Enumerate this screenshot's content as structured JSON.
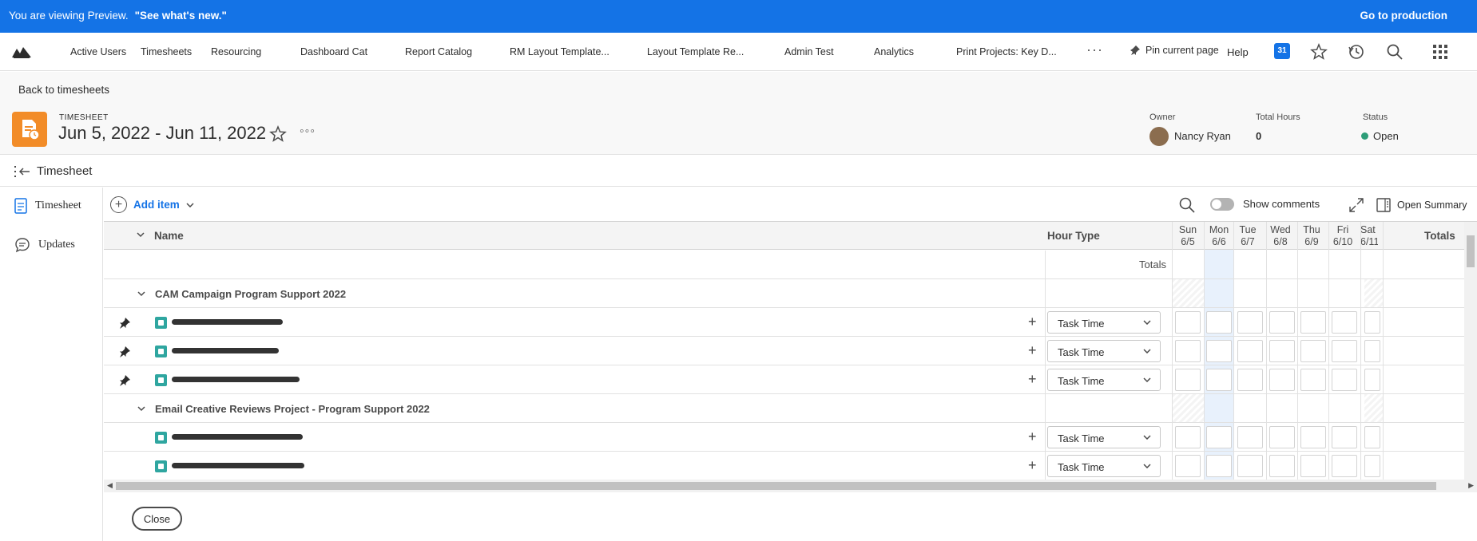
{
  "banner": {
    "message": "You are viewing Preview.",
    "link": "\"See what's new.\"",
    "production": "Go to production"
  },
  "nav": {
    "items": [
      "Active Users",
      "Timesheets",
      "Resourcing",
      "Dashboard Cat",
      "Report Catalog",
      "RM Layout Template...",
      "Layout Template Re...",
      "Admin Test",
      "Analytics",
      "Print Projects: Key D..."
    ],
    "more": "···",
    "pin": "Pin current page",
    "help": "Help",
    "calendar_badge": "31",
    "icons": [
      "logo-icon",
      "pin-icon",
      "calendar-icon",
      "star-icon",
      "history-icon",
      "search-icon",
      "apps-grid-icon"
    ]
  },
  "header": {
    "back": "Back to timesheets",
    "label": "TIMESHEET",
    "title": "Jun 5, 2022 - Jun 11, 2022",
    "more": "◦◦◦",
    "owner_label": "Owner",
    "owner": "Nancy Ryan",
    "hours_label": "Total Hours",
    "hours": "0",
    "status_label": "Status",
    "status": "Open",
    "status_color": "#2d9d78"
  },
  "section": {
    "title": "Timesheet"
  },
  "sidenav": {
    "items": [
      "Timesheet",
      "Updates"
    ]
  },
  "toolbar": {
    "add_item": "Add item",
    "show_comments": "Show comments",
    "open_summary": "Open Summary"
  },
  "grid": {
    "name_header": "Name",
    "hour_type_header": "Hour Type",
    "days": [
      {
        "day": "Sun",
        "date": "6/5"
      },
      {
        "day": "Mon",
        "date": "6/6"
      },
      {
        "day": "Tue",
        "date": "6/7"
      },
      {
        "day": "Wed",
        "date": "6/8"
      },
      {
        "day": "Thu",
        "date": "6/9"
      },
      {
        "day": "Fri",
        "date": "6/10"
      },
      {
        "day": "Sat",
        "date": "6/11"
      }
    ],
    "totals_header": "Totals",
    "totals_row_label": "Totals",
    "groups": [
      {
        "title": "CAM Campaign Program Support 2022"
      },
      {
        "title": "Email Creative Reviews Project - Program Support 2022"
      }
    ],
    "hour_type": "Task Time"
  },
  "footer": {
    "close": "Close"
  },
  "colors": {
    "brand_blue": "#1473e6",
    "timesheet_orange": "#f28c28",
    "task_teal": "#2fa6a0"
  }
}
